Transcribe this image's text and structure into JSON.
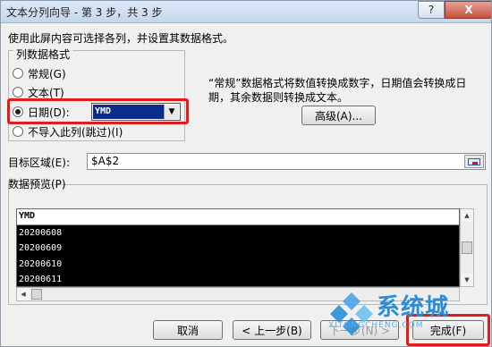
{
  "window": {
    "title": "文本分列向导 - 第 3 步，共 3 步",
    "help_label": "?",
    "close_label": "X"
  },
  "instruction": "使用此屏内容可选择各列，并设置其数据格式。",
  "column_format": {
    "group_label": "列数据格式",
    "options": [
      {
        "label": "常规(G)",
        "checked": false
      },
      {
        "label": "文本(T)",
        "checked": false
      },
      {
        "label": "日期(D):",
        "checked": true
      },
      {
        "label": "不导入此列(跳过)(I)",
        "checked": false
      }
    ],
    "date_format_value": "YMD"
  },
  "description": "“常规”数据格式将数值转换成数字，日期值会转换成日期，其余数据则转换成文本。",
  "advanced_button": "高级(A)...",
  "destination": {
    "label": "目标区域(E):",
    "value": "$A$2"
  },
  "preview": {
    "label": "数据预览(P)",
    "header": "YMD",
    "rows": [
      "20200608",
      "20200609",
      "20200610",
      "20200611"
    ]
  },
  "buttons": {
    "cancel": "取消",
    "back": "< 上一步(B)",
    "next": "下一步(N) >",
    "finish": "完成(F)"
  },
  "watermark": {
    "brand": "系统城",
    "url": "XITONGCHENG.COM"
  },
  "colors": {
    "highlight": "#e21c1c",
    "selection": "#0a2c8c",
    "watermark": "#2a8ed6"
  }
}
